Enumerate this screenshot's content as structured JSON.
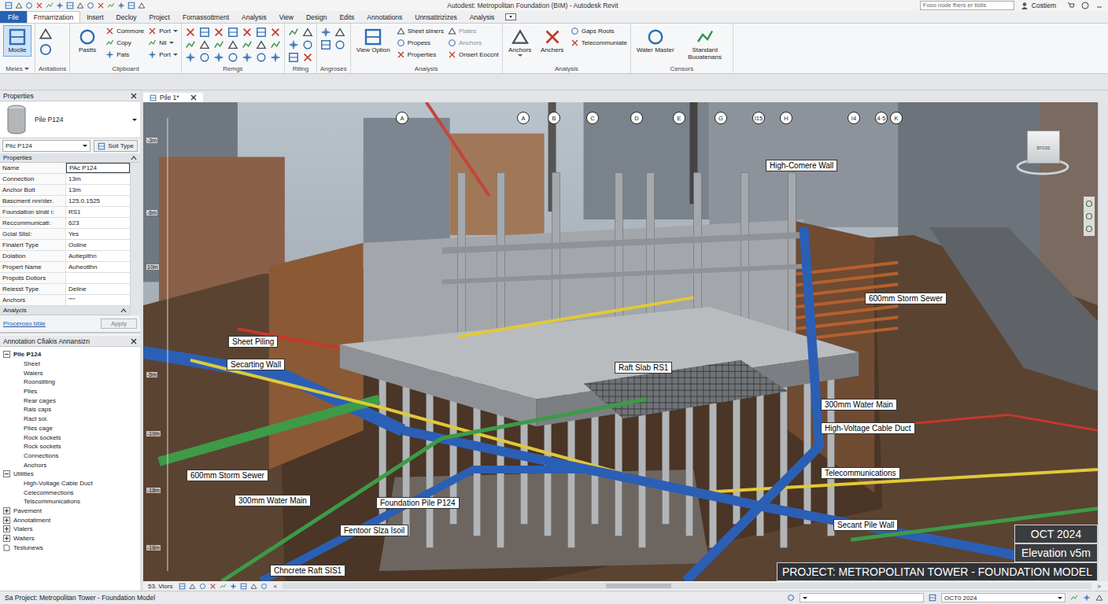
{
  "title_bar": {
    "title": "Autodest: Metropolitan Foundation (BIM) - Autodesk Revit",
    "search": {
      "placeholder": "Fooo node fhers er tistis"
    },
    "user": "Costiem"
  },
  "tabs": [
    {
      "label": "File",
      "kind": "file",
      "selected": false
    },
    {
      "label": "Frrnarrization",
      "kind": "tab",
      "selected": true
    },
    {
      "label": "Insert",
      "kind": "tab",
      "selected": false
    },
    {
      "label": "Decloy",
      "kind": "tab",
      "selected": false
    },
    {
      "label": "Project",
      "kind": "tab",
      "selected": false
    },
    {
      "label": "Fornassottment",
      "kind": "tab",
      "selected": false
    },
    {
      "label": "Analysis",
      "kind": "tab",
      "selected": false
    },
    {
      "label": "View",
      "kind": "tab",
      "selected": false
    },
    {
      "label": "Design",
      "kind": "tab",
      "selected": false
    },
    {
      "label": "Edits",
      "kind": "tab",
      "selected": false
    },
    {
      "label": "Annotations",
      "kind": "tab",
      "selected": false
    },
    {
      "label": "Unnsattrizizes",
      "kind": "tab",
      "selected": false
    },
    {
      "label": "Analysis",
      "kind": "tab",
      "selected": false
    }
  ],
  "ribbon": [
    {
      "title": "Meies",
      "dropdown": true,
      "groups": [
        {
          "kind": "large",
          "items": [
            {
              "label": "Mocile",
              "selected": true,
              "disabled": false,
              "dropdown": false
            }
          ]
        }
      ]
    },
    {
      "title": "Anitations",
      "dropdown": false,
      "groups": [
        {
          "kind": "icons",
          "items": []
        }
      ]
    },
    {
      "title": "Clipboard",
      "dropdown": false,
      "groups": [
        {
          "kind": "large",
          "items": [
            {
              "label": "Pastts",
              "selected": false,
              "disabled": false,
              "dropdown": false
            }
          ]
        },
        {
          "kind": "small",
          "items": [
            {
              "label": "Commore",
              "selected": false,
              "disabled": false,
              "dropdown": false
            },
            {
              "label": "Copy",
              "selected": false,
              "disabled": false,
              "dropdown": false
            },
            {
              "label": "Pats",
              "selected": false,
              "disabled": false,
              "dropdown": false
            }
          ]
        },
        {
          "kind": "small",
          "items": [
            {
              "label": "Port",
              "selected": false,
              "disabled": false,
              "dropdown": true
            },
            {
              "label": "Nil",
              "selected": false,
              "disabled": false,
              "dropdown": true
            },
            {
              "label": "Port",
              "selected": false,
              "disabled": false,
              "dropdown": true
            }
          ]
        }
      ]
    },
    {
      "title": "Remgs",
      "dropdown": false,
      "groups": [
        {
          "kind": "icons",
          "items": []
        }
      ]
    },
    {
      "title": "Riting",
      "dropdown": false,
      "groups": [
        {
          "kind": "icons",
          "items": []
        }
      ]
    },
    {
      "title": "Angroses",
      "dropdown": false,
      "groups": [
        {
          "kind": "icons",
          "items": []
        }
      ]
    },
    {
      "title": "Analysis",
      "dropdown": false,
      "groups": [
        {
          "kind": "large",
          "items": [
            {
              "label": "View Option",
              "selected": false,
              "disabled": false,
              "dropdown": false
            }
          ]
        },
        {
          "kind": "small",
          "items": [
            {
              "label": "Sheet sliners",
              "selected": false,
              "disabled": false,
              "dropdown": false
            },
            {
              "label": "Propess",
              "selected": false,
              "disabled": false,
              "dropdown": false
            },
            {
              "label": "Properties",
              "selected": false,
              "disabled": false,
              "dropdown": false
            }
          ]
        },
        {
          "kind": "small",
          "items": [
            {
              "label": "Plates",
              "selected": false,
              "disabled": true,
              "dropdown": false
            },
            {
              "label": "Anchors",
              "selected": false,
              "disabled": true,
              "dropdown": false
            },
            {
              "label": "Onsert Eoccnt",
              "selected": false,
              "disabled": false,
              "dropdown": false
            }
          ]
        }
      ]
    },
    {
      "title": "Analysis",
      "dropdown": false,
      "groups": [
        {
          "kind": "large",
          "items": [
            {
              "label": "Anchors",
              "selected": false,
              "disabled": false,
              "dropdown": true
            },
            {
              "label": "Anchers",
              "selected": false,
              "disabled": false,
              "dropdown": false
            }
          ]
        },
        {
          "kind": "small",
          "items": [
            {
              "label": "Gaps Rools",
              "selected": false,
              "disabled": false,
              "dropdown": false
            },
            {
              "label": "Telecommuniate",
              "selected": false,
              "disabled": false,
              "dropdown": false
            }
          ]
        }
      ]
    },
    {
      "title": "Censors",
      "dropdown": false,
      "groups": [
        {
          "kind": "large",
          "items": [
            {
              "label": "Water Master",
              "selected": false,
              "disabled": false,
              "dropdown": false
            },
            {
              "label": "Standard Buoatenans",
              "selected": false,
              "disabled": false,
              "dropdown": false
            }
          ]
        }
      ]
    }
  ],
  "properties": {
    "title": "Properties",
    "type_name": "Pile P124",
    "instance": "Pilc P124",
    "edit_type": "Soil Type",
    "section": "Properties",
    "rows": [
      {
        "name": "Name",
        "value": "PAc P124",
        "editing": true
      },
      {
        "name": "Connection",
        "value": "13m",
        "editing": false
      },
      {
        "name": "Anchor Bolt",
        "value": "13m",
        "editing": false
      },
      {
        "name": "Bascment nnr/der.",
        "value": "125.0.1525",
        "editing": false
      },
      {
        "name": "Foundation sinát ı:",
        "value": "RS1",
        "editing": false
      },
      {
        "name": "Reccommunicati:",
        "value": "623",
        "editing": false
      },
      {
        "name": "Gcial Slisl:",
        "value": "Yes",
        "editing": false
      },
      {
        "name": "Finalert Type",
        "value": "Ooline",
        "editing": false
      },
      {
        "name": "Dolation",
        "value": "Autieplthn",
        "editing": false
      },
      {
        "name": "Propert Name",
        "value": "Auheotthn",
        "editing": false
      },
      {
        "name": "Propots Dotiors",
        "value": "",
        "editing": false
      },
      {
        "name": "Reiesst Type",
        "value": "Deline",
        "editing": false
      },
      {
        "name": "Anchors",
        "value": "\"\"\"",
        "editing": false
      }
    ],
    "section2": "Analycis",
    "link": "Proceroso bble",
    "apply": {
      "label": "Apply",
      "disabled": true
    }
  },
  "browser": {
    "title": "Annotation Cfiakis Annansizn",
    "items": [
      {
        "label": "Pile P124",
        "expanded": true,
        "has_children": true,
        "children": [
          "Sheet",
          "Walers",
          "Roonstiting",
          "Piles",
          "Rear cages",
          "Rais caps",
          "Ract soi.",
          "Piles cage",
          "Rock sockets",
          "Rock sockets",
          "Connections",
          "Anchors"
        ]
      },
      {
        "label": "Utilities",
        "expanded": true,
        "has_children": true,
        "children": [
          "High-Voltage Cable Duct",
          "Celecommections",
          "Telscommunications"
        ]
      },
      {
        "label": "Pavement",
        "expanded": false,
        "has_children": true,
        "children": []
      },
      {
        "label": "Annotatiment",
        "expanded": false,
        "has_children": true,
        "children": []
      },
      {
        "label": "Vlalers",
        "expanded": false,
        "has_children": true,
        "children": []
      },
      {
        "label": "Waiters",
        "expanded": false,
        "has_children": true,
        "children": []
      },
      {
        "label": "Testunews",
        "expanded": false,
        "has_children": false,
        "children": []
      }
    ]
  },
  "view": {
    "tab": {
      "label": "Pile 1*",
      "selected": true
    },
    "grid": [
      "A",
      "A",
      "B",
      "C",
      "D",
      "E",
      "G",
      "I15",
      "H",
      "I4",
      "4·5",
      "K"
    ],
    "elevations": [
      "-3m",
      "-6m",
      "10m",
      "-5m",
      "-10m",
      "-18m",
      "-18m"
    ],
    "labels": [
      "High-Comere Wall",
      "600mm Storm Sewer",
      "Sheet Piling",
      "Secarting Wall",
      "Raft Slab RS1",
      "300mm Water Main",
      "High-Voltage Cable Duct",
      "Telecommunications",
      "600mm Storm Sewer",
      "300mm Water Main",
      "Foundation Pile P124",
      "Fentoor Slza Isoil",
      "Secant Pile Wall",
      "Chncrete Raft SIS1"
    ],
    "viewcube": "ercos",
    "info": [
      "OCT 2024",
      "Elevation v5m",
      "PROJECT: METROPOLITAN TOWER - FOUNDATION MODEL"
    ]
  },
  "view_bar": {
    "scale": "53. Viors",
    "prev": "<",
    "next": ">"
  },
  "status_bar": {
    "text": "Sa Project: Metropolitan Tower - Foundation Model",
    "date": "OCT0 2024"
  }
}
